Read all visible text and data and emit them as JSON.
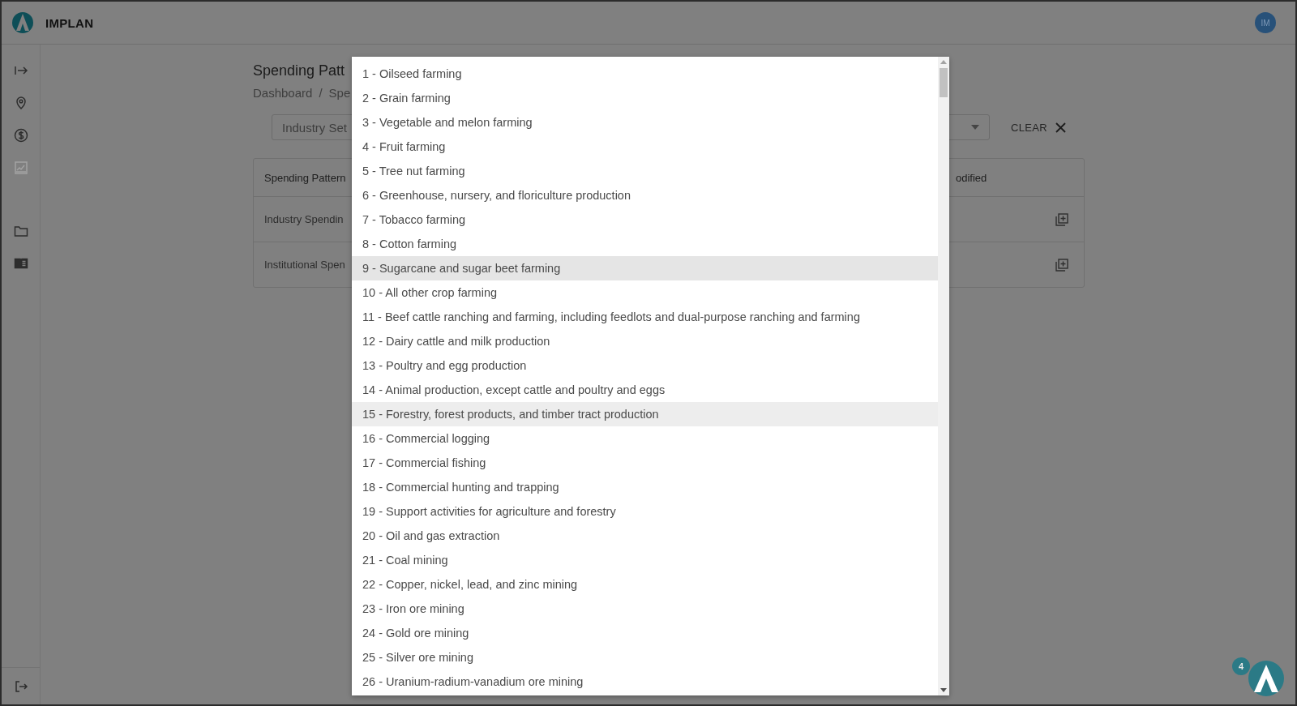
{
  "app": {
    "name": "IMPLAN",
    "avatar": "IM",
    "assistant_badge": "4"
  },
  "sidebar": {
    "groups": [
      [
        {
          "kind": "expand",
          "disabled": false
        },
        {
          "kind": "pin",
          "disabled": false
        },
        {
          "kind": "dollar",
          "disabled": false
        },
        {
          "kind": "chart",
          "disabled": true
        }
      ],
      [
        {
          "kind": "folder",
          "disabled": false
        },
        {
          "kind": "book",
          "disabled": false
        }
      ]
    ],
    "bottom": {
      "kind": "logout",
      "disabled": false
    }
  },
  "page": {
    "title": "Spending Patt",
    "breadcrumb": [
      "Dashboard",
      "Spe"
    ],
    "breadcrumb_separator": "/",
    "filter": {
      "placeholder": "Industry Set"
    },
    "clear": "CLEAR",
    "table": {
      "columns": [
        "Spending Pattern",
        "odified"
      ],
      "rows": [
        {
          "name": "Industry Spendin"
        },
        {
          "name": "Institutional Spen"
        }
      ]
    }
  },
  "dropdown": {
    "items": [
      {
        "label": "1 - Oilseed farming",
        "selected": false,
        "hovered": false
      },
      {
        "label": "2 - Grain farming",
        "selected": false,
        "hovered": false
      },
      {
        "label": "3 - Vegetable and melon farming",
        "selected": false,
        "hovered": false
      },
      {
        "label": "4 - Fruit farming",
        "selected": false,
        "hovered": false
      },
      {
        "label": "5 - Tree nut farming",
        "selected": false,
        "hovered": false
      },
      {
        "label": "6 - Greenhouse, nursery, and floriculture production",
        "selected": false,
        "hovered": false
      },
      {
        "label": "7 - Tobacco farming",
        "selected": false,
        "hovered": false
      },
      {
        "label": "8 - Cotton farming",
        "selected": false,
        "hovered": false
      },
      {
        "label": "9 - Sugarcane and sugar beet farming",
        "selected": true,
        "hovered": false
      },
      {
        "label": "10 - All other crop farming",
        "selected": false,
        "hovered": false
      },
      {
        "label": "11 - Beef cattle ranching and farming, including feedlots and dual-purpose ranching and farming",
        "selected": false,
        "hovered": false
      },
      {
        "label": "12 - Dairy cattle and milk production",
        "selected": false,
        "hovered": false
      },
      {
        "label": "13 - Poultry and egg production",
        "selected": false,
        "hovered": false
      },
      {
        "label": "14 - Animal production, except cattle and poultry and eggs",
        "selected": false,
        "hovered": false
      },
      {
        "label": "15 - Forestry, forest products, and timber tract production",
        "selected": false,
        "hovered": true
      },
      {
        "label": "16 - Commercial logging",
        "selected": false,
        "hovered": false
      },
      {
        "label": "17 - Commercial fishing",
        "selected": false,
        "hovered": false
      },
      {
        "label": "18 - Commercial hunting and trapping",
        "selected": false,
        "hovered": false
      },
      {
        "label": "19 - Support activities for agriculture and forestry",
        "selected": false,
        "hovered": false
      },
      {
        "label": "20 - Oil and gas extraction",
        "selected": false,
        "hovered": false
      },
      {
        "label": "21 - Coal mining",
        "selected": false,
        "hovered": false
      },
      {
        "label": "22 - Copper, nickel, lead, and zinc mining",
        "selected": false,
        "hovered": false
      },
      {
        "label": "23 - Iron ore mining",
        "selected": false,
        "hovered": false
      },
      {
        "label": "24 - Gold ore mining",
        "selected": false,
        "hovered": false
      },
      {
        "label": "25 - Silver ore mining",
        "selected": false,
        "hovered": false
      },
      {
        "label": "26 - Uranium-radium-vanadium ore mining",
        "selected": false,
        "hovered": false
      }
    ]
  }
}
